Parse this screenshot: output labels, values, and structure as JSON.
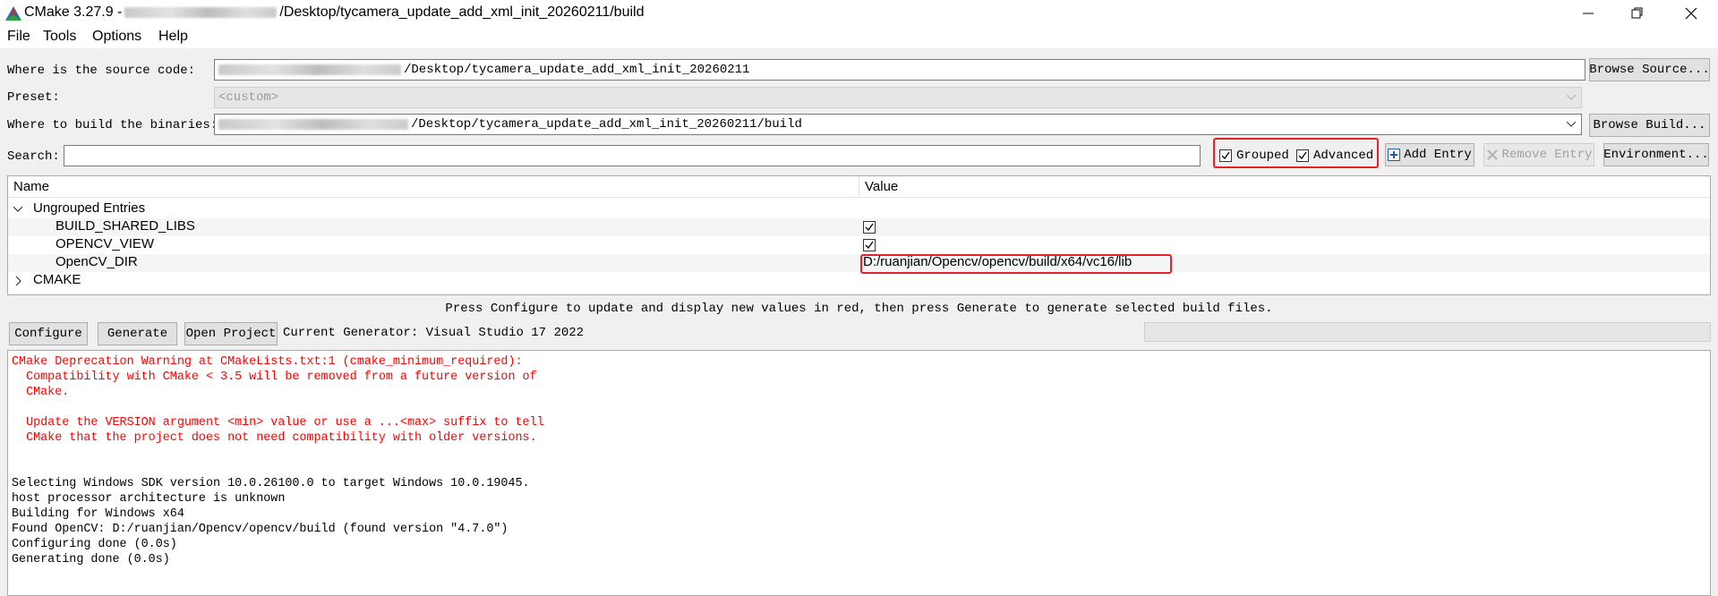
{
  "window": {
    "title_prefix": "CMake 3.27.9 -",
    "title_suffix": "/Desktop/tycamera_update_add_xml_init_20260211/build"
  },
  "menu": {
    "file": "File",
    "tools": "Tools",
    "options": "Options",
    "help": "Help"
  },
  "source": {
    "label": "Where is the source code:",
    "value_suffix": "/Desktop/tycamera_update_add_xml_init_20260211",
    "browse": "Browse Source..."
  },
  "preset": {
    "label": "Preset:",
    "value": "<custom>"
  },
  "build": {
    "label": "Where to build the binaries:",
    "value_suffix": "/Desktop/tycamera_update_add_xml_init_20260211/build",
    "browse": "Browse Build..."
  },
  "search": {
    "label": "Search:",
    "value": "",
    "grouped_label": "Grouped",
    "grouped_checked": true,
    "advanced_label": "Advanced",
    "advanced_checked": true,
    "add_entry": "Add Entry",
    "remove_entry": "Remove Entry",
    "environment": "Environment..."
  },
  "tree": {
    "col_name": "Name",
    "col_value": "Value",
    "group_ungrouped": "Ungrouped Entries",
    "entries": [
      {
        "name": "BUILD_SHARED_LIBS",
        "checked": true
      },
      {
        "name": "OPENCV_VIEW",
        "checked": true
      },
      {
        "name": "OpenCV_DIR",
        "value": "D:/ruanjian/Opencv/opencv/build/x64/vc16/lib"
      }
    ],
    "group_cmake": "CMAKE"
  },
  "status_message": "Press Configure to update and display new values in red, then press Generate to generate selected build files.",
  "actions": {
    "configure": "Configure",
    "generate": "Generate",
    "open_project": "Open Project",
    "generator": "Current Generator: Visual Studio 17 2022"
  },
  "output": {
    "warning_lines": [
      "CMake Deprecation Warning at CMakeLists.txt:1 (cmake_minimum_required):",
      "  Compatibility with CMake < 3.5 will be removed from a future version of",
      "  CMake.",
      "",
      "  Update the VERSION argument <min> value or use a ...<max> suffix to tell",
      "  CMake that the project does not need compatibility with older versions."
    ],
    "info_lines": [
      "Selecting Windows SDK version 10.0.26100.0 to target Windows 10.0.19045.",
      "host processor architecture is unknown",
      "Building for Windows x64",
      "Found OpenCV: D:/ruanjian/Opencv/opencv/build (found version \"4.7.0\")",
      "Configuring done (0.0s)",
      "Generating done (0.0s)"
    ]
  },
  "colors": {
    "warning_text": "#ff0000",
    "annotation_box": "#e8202a"
  }
}
